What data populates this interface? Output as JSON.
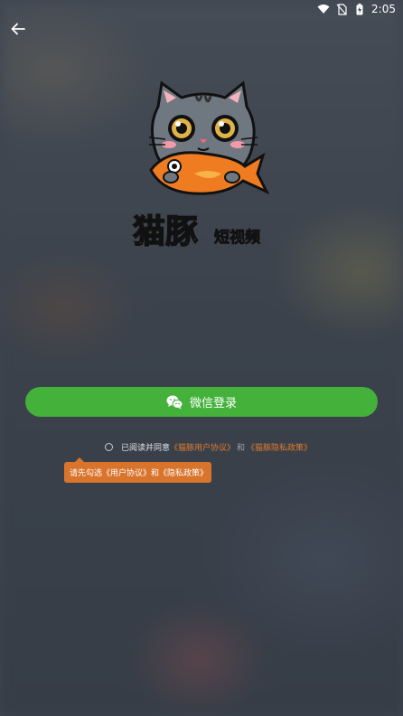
{
  "status_bar": {
    "time": "2:05",
    "icons": [
      "wifi-icon",
      "no-sim-icon",
      "battery-charging-icon"
    ]
  },
  "back": {
    "icon": "back-arrow-icon"
  },
  "logo": {
    "brand_main": "猫豚",
    "brand_sub": "短视频"
  },
  "login": {
    "wechat_label": "微信登录",
    "icon": "wechat-icon",
    "color": "#43b13a"
  },
  "agreement": {
    "prefix": "已阅读并同意",
    "user_agreement": "《猫豚用户协议》",
    "separator": "和",
    "privacy_policy": "《猫豚隐私政策》",
    "link_color": "#e07a2e"
  },
  "tooltip": {
    "text": "请先勾选《用户协议》和《隐私政策》",
    "color": "#d9742c"
  }
}
